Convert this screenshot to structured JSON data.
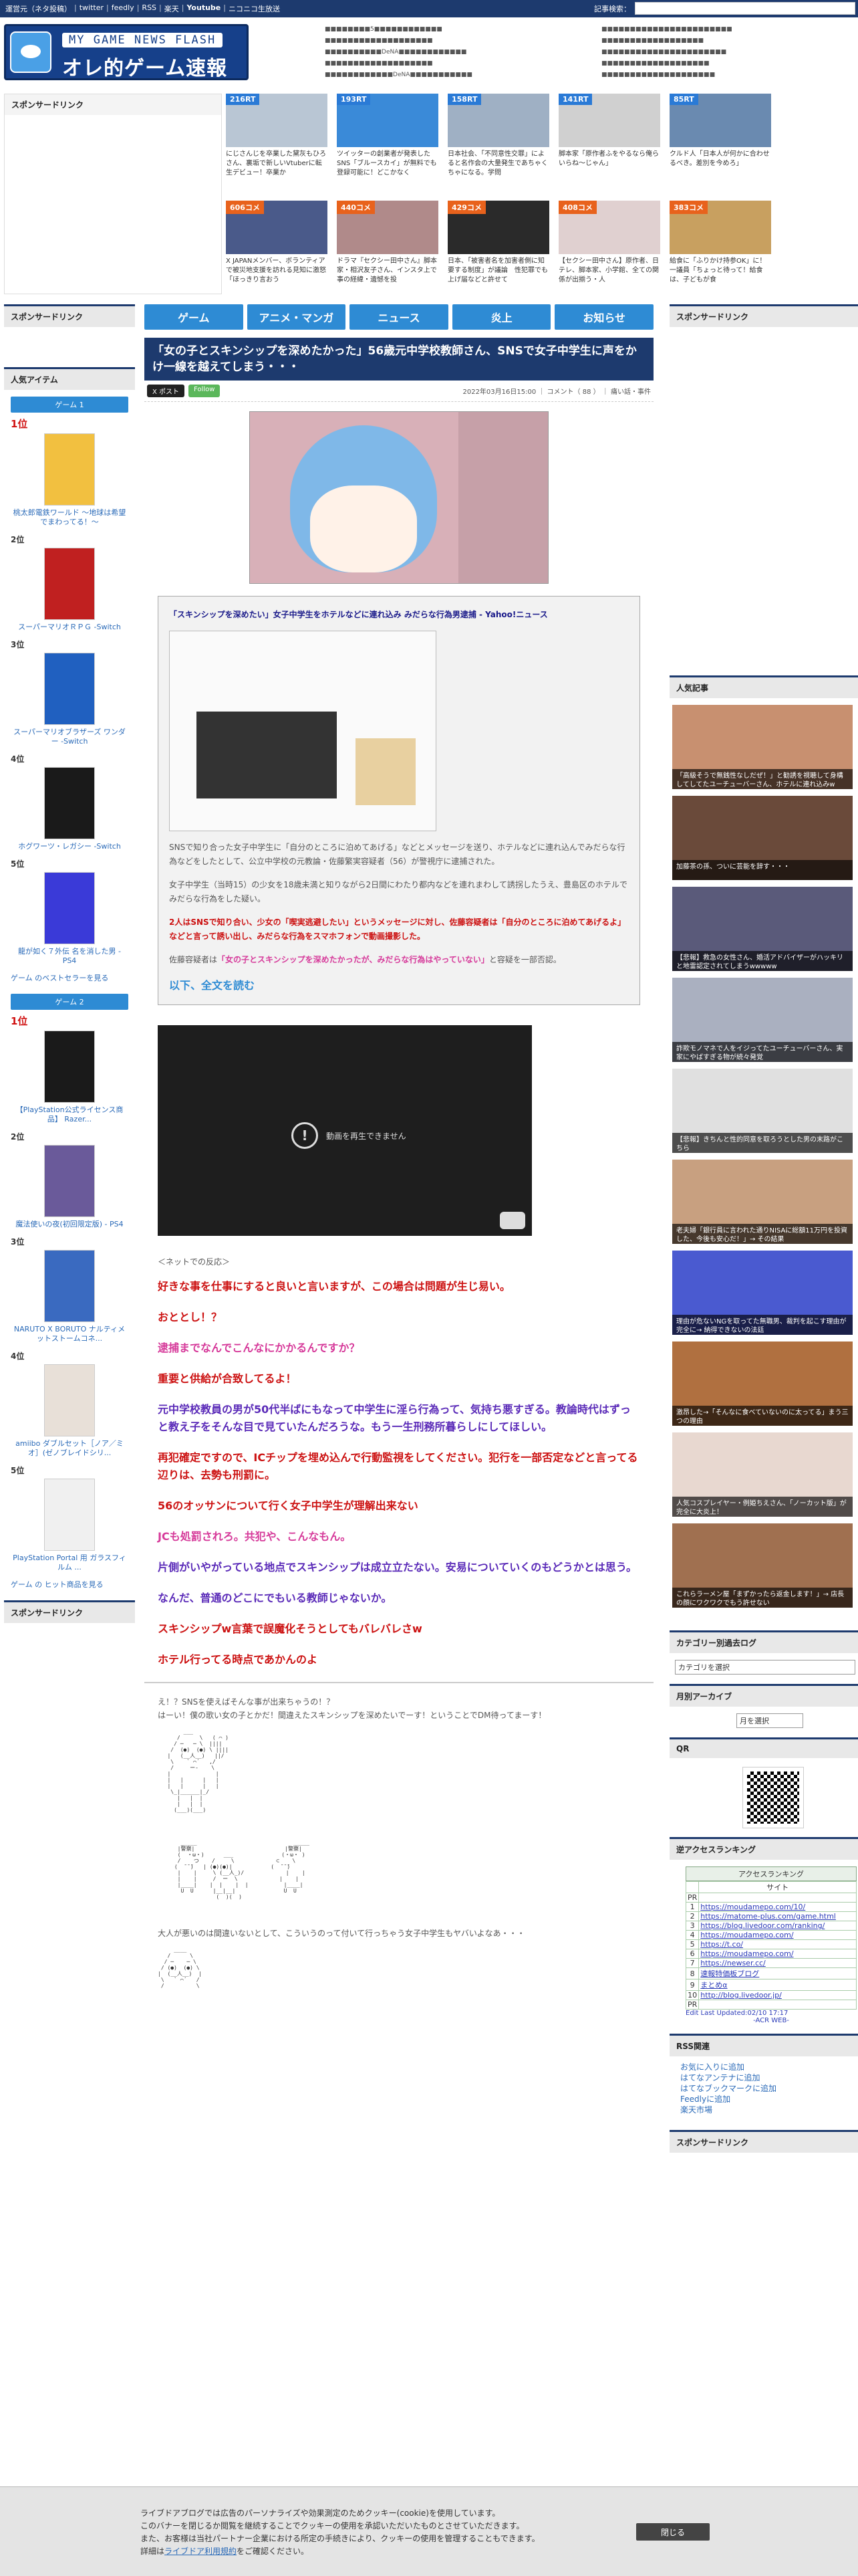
{
  "topbar": {
    "links": [
      "運営元（ネタ投稿）",
      "twitter",
      "feedly",
      "RSS",
      "楽天",
      "Youtube",
      "ニコニコ生放送"
    ],
    "search_label": "記事検索：",
    "search_placeholder": ""
  },
  "logo": {
    "line1": "MY GAME NEWS FLASH",
    "line2": "オレ的ゲーム速報@JIN"
  },
  "header_lists": {
    "col1": [
      "■■■■■■■■5■■■■■■■■■■■■",
      "■■■■■■■■■■■■■■■■■■■",
      "■■■■■■■■■■DeNA■■■■■■■■■■■■",
      "■■■■■■■■■■■■■■■■■■■",
      "■■■■■■■■■■■■DeNA■■■■■■■■■■■"
    ],
    "col2": [
      "■■■■■■■■■■■■■■■■■■■■■■■",
      "■■■■■■■■■■■■■■■■■■",
      "■■■■■■■■■■■■■■■■■■■■■■",
      "■■■■■■■■■■■■■■■■■■■",
      "■■■■■■■■■■■■■■■■■■■■"
    ],
    "col3": [
      "■■■■■■■■■■■■■■■",
      "■■■■■■■■■■■■■■■■■■■■■",
      "■■■■■■■■■■■■■■■(■)■■",
      "■■■■■■■■■■■■■■■■■■■",
      "MSI■Steam■■■■■■■■■■■"
    ]
  },
  "side": {
    "sponsor_title": "スポンサードリンク",
    "popular_items_title": "人気アイテム",
    "popular_articles_title": "人気記事",
    "category_title": "カテゴリー別過去ログ",
    "category_select": "カテゴリを選択",
    "monthly_title": "月別アーカイブ",
    "monthly_select": "月を選択",
    "qr_title": "QR",
    "access_title": "逆アクセスランキング",
    "rss_title": "RSS関連"
  },
  "thumbs": [
    {
      "tag": "216RT",
      "text": "にじさんじを卒業した黛灰もひろさん、裏垢で新しいVtuberに転生デビュー！卒業か",
      "kind": "rt"
    },
    {
      "tag": "193RT",
      "text": "ツイッターの創業者が発表したSNS「ブルースカイ」が無料でも登録可能に！どこかなく",
      "kind": "rt"
    },
    {
      "tag": "158RT",
      "text": "日本社会、「不同意性交罪」によると名作会の大量発生であちゃくちゃになる。学問",
      "kind": "rt"
    },
    {
      "tag": "141RT",
      "text": "脚本家「原作者ふをやるなら俺らいらね〜じゃん」",
      "kind": "rt"
    },
    {
      "tag": "85RT",
      "text": "クルド人「日本人が何かに合わせるべき。差別を今めろ」",
      "kind": "rt"
    },
    {
      "tag": "606コメ",
      "text": "X JAPANメンバー、ボランティアで被災地支援を訪れる見知に激怒「ほっきり言おう",
      "kind": "cmt"
    },
    {
      "tag": "440コメ",
      "text": "ドラマ『セクシー田中さん』脚本家・相沢友子さん、インスタ上で事の経緯・遺憾を投",
      "kind": "cmt"
    },
    {
      "tag": "429コメ",
      "text": "日本、「被害者名を加害者側に知要する制度」が議論　性犯罪でも上げ届などと許せて",
      "kind": "cmt"
    },
    {
      "tag": "408コメ",
      "text": "【セクシー田中さん】原作者、日テレ、脚本家、小学館、全ての関係が出揃う・人",
      "kind": "cmt"
    },
    {
      "tag": "383コメ",
      "text": "給食に「ふりかけ持参OK」に！一議員「ちょっと待って！給食は、子どもが食",
      "kind": "cmt"
    }
  ],
  "nav": [
    "ゲーム",
    "アニメ・マンガ",
    "ニュース",
    "炎上",
    "お知らせ"
  ],
  "rank_groups": [
    {
      "head": "ゲーム 1",
      "items": [
        {
          "num": "1位",
          "name": "桃太郎電鉄ワールド ～地球は希望でまわってる！～"
        },
        {
          "num": "2位",
          "name": "スーパーマリオＲＰＧ -Switch"
        },
        {
          "num": "3位",
          "name": "スーパーマリオブラザーズ ワンダー -Switch"
        },
        {
          "num": "4位",
          "name": "ホグワーツ・レガシー -Switch"
        },
        {
          "num": "5位",
          "name": "龍が如く７外伝 名を消した男 - PS4"
        }
      ],
      "more": "ゲーム のベストセラーを見る"
    },
    {
      "head": "ゲーム 2",
      "items": [
        {
          "num": "1位",
          "name": "【PlayStation公式ライセンス商品】 Razer..."
        },
        {
          "num": "2位",
          "name": "魔法使いの夜(初回限定版) - PS4"
        },
        {
          "num": "3位",
          "name": "NARUTO X BORUTO ナルティメットストームコネ..."
        },
        {
          "num": "4位",
          "name": "amiibo ダブルセット［ノア／ミオ］(ゼノブレイドシリ..."
        },
        {
          "num": "5位",
          "name": "PlayStation Portal 用 ガラスフィルム ..."
        }
      ],
      "more": "ゲーム の ヒット商品を見る"
    }
  ],
  "article": {
    "title": "「女の子とスキンシップを深めたかった」56歳元中学校教師さん、SNSで女子中学生に声をかけ一線を越えてしまう・・・",
    "x_button": "X ポスト",
    "follow_button": "Follow",
    "meta": "2022年03月16日15:00 ｜ コメント（ 88 ） ｜ 痛い話・事件",
    "quote_title": "「スキンシップを深めたい」女子中学生をホテルなどに連れ込み みだらな行為男逮捕 - Yahoo!ニュース",
    "p1": "SNSで知り合った女子中学生に「自分のところに泊めてあげる」などとメッセージを送り、ホテルなどに連れ込んでみだらな行為などをしたとして、公立中学校の元教論・佐藤繁実容疑者（56）が警視庁に逮捕された。",
    "p2": "女子中学生（当時15）の少女を18歳未満と知りながら2日間にわたり都内などを連れまわして誘拐したうえ、豊島区のホテルでみだらな行為をした疑い。",
    "p3": "2人はSNSで知り合い、少女の「喫実逃避したい」というメッセージに対し、佐藤容疑者は「自分のところに泊めてあげるよ」などと言って誘い出し、みだらな行為をスマホフォンで動画撮影した。",
    "p4a": "佐藤容疑者は",
    "p4b": "「女の子とスキンシップを深めたかったが、みだらな行為はやっていない」",
    "p4c": "と容疑を一部否認。",
    "readmore": "以下、全文を読む",
    "video_error": "動画を再生できません",
    "react_head": "＜ネットでの反応＞",
    "comments": [
      {
        "text": "好きな事を仕事にすると良いと言いますが、この場合は問題が生じ易い。",
        "color": "#cc1111"
      },
      {
        "text": "おととし！？",
        "color": "#cc1111"
      },
      {
        "text": "逮捕までなんでこんなにかかるんですか？",
        "color": "#d63a9a"
      },
      {
        "text": "重要と供給が合致してるよ！",
        "color": "#cc1111"
      },
      {
        "text": "元中学校教員の男が50代半ばにもなって中学生に淫ら行為って、気持ち悪すぎる。教論時代はずっと教え子をそんな目で見ていたんだろうな。もう一生刑務所暮らしにしてほしい。",
        "color": "#5a2ab8"
      },
      {
        "text": "再犯確定ですので、ICチップを埋め込んで行動監視をしてください。犯行を一部否定などと言ってる辺りは、去勢も刑罰に。",
        "color": "#cc1111"
      },
      {
        "text": "56のオッサンについて行く女子中学生が理解出来ない",
        "color": "#cc1111"
      },
      {
        "text": "JCも処罰されろ。共犯や、こんなもん。",
        "color": "#d63a9a"
      },
      {
        "text": "片側がいやがっている地点でスキンシップは成立立たない。安易についていくのもどうかとは思う。",
        "color": "#5a2ab8"
      },
      {
        "text": "なんだ、普通のどこにでもいる教師じゃないか。",
        "color": "#5a2ab8"
      },
      {
        "text": "スキンシップw言葉で誤魔化そうとしてもバレバレさw",
        "color": "#cc1111"
      },
      {
        "text": "ホテル行ってる時点であかんのよ",
        "color": "#cc1111"
      }
    ],
    "aa_text1": "え！？SNSを使えばそんな事が出来ちゃうの！？",
    "aa_text2": "はーい！僕の歌い女の子とかだ！間違えたスキンシップを深めたいでーす！ということでDM待ってまーす！",
    "aa_text3": "大人が悪いのは間違いないとして、こういうのって付いて行っちゃう女子中学生もヤバいよなあ・・・"
  },
  "popular_articles": [
    "「高級そうで無銭性なしだぜ！」と勧誘を視聴して身構してしてたユーチューバーさん、ホテルに連れ込みw",
    "加藤茶の孫、ついに芸能を辞す・・・",
    "【悲報】救急の女性さん、婚活アドバイザーがハッキリと地雷認定されてしまうwwwww",
    "詐欺モノマネで人をイジってたユーチューバーさん、実家にやばすぎる物が続々発覚",
    "【悲報】きちんと性的同意を取ろうとした男の末路がこちら",
    "老夫婦「銀行員に言われた通りNISAに総額11万円を投資した、今後も安心だ！」→ その結果",
    "理由が危ないNGを取ってた無職男、裁判を起こす理由が完全に→ 納得できないの法廷",
    "激昂した→「そんなに食べていないのに太ってる」まう三つの理由",
    "人気コスプレイヤー・例姫ちえさん、「ノーカット版」が完全に大炎上！",
    "これらラーメン屋「まずかったら返金します！」→ 店長の顔にワクワクでもう許せない"
  ],
  "access_ranking": {
    "title": "アクセスランキング",
    "site_col": "サイト",
    "rows": [
      {
        "n": "PR",
        "site": ""
      },
      {
        "n": "1",
        "site": "https://moudamepo.com/10/"
      },
      {
        "n": "2",
        "site": "https://matome-plus.com/game.html"
      },
      {
        "n": "3",
        "site": "https://blog.livedoor.com/ranking/"
      },
      {
        "n": "4",
        "site": "https://moudamepo.com/"
      },
      {
        "n": "5",
        "site": "https://t.co/"
      },
      {
        "n": "6",
        "site": "https://moudamepo.com/"
      },
      {
        "n": "7",
        "site": "https://newser.cc/"
      },
      {
        "n": "8",
        "site": "速報特価板ブログ"
      },
      {
        "n": "9",
        "site": "まとめα"
      },
      {
        "n": "10",
        "site": "http://blog.livedoor.jp/"
      },
      {
        "n": "PR",
        "site": ""
      }
    ],
    "footer": "Edit Last Updated:02/10 17:17",
    "footer2": "-ACR WEB-"
  },
  "rss": [
    "お気に入りに追加",
    "はてなアンテナに追加",
    "はてなブックマークに追加",
    "Feedlyに追加",
    "楽天市場"
  ],
  "cookie": {
    "line1": "ライブドアブログでは広告のパーソナライズや効果測定のためクッキー(cookie)を使用しています。",
    "line2": "このバナーを閉じるか閲覧を継続することでクッキーの使用を承認いただいたものとさせていただきます。",
    "line3": "また、お客様は当社パートナー企業における所定の手続きにより、クッキーの使用を管理することもできます。",
    "line4_pre": "詳細は",
    "line4_link": "ライブドア利用規約",
    "line4_post": "をご確認ください。",
    "close": "閉じる"
  }
}
